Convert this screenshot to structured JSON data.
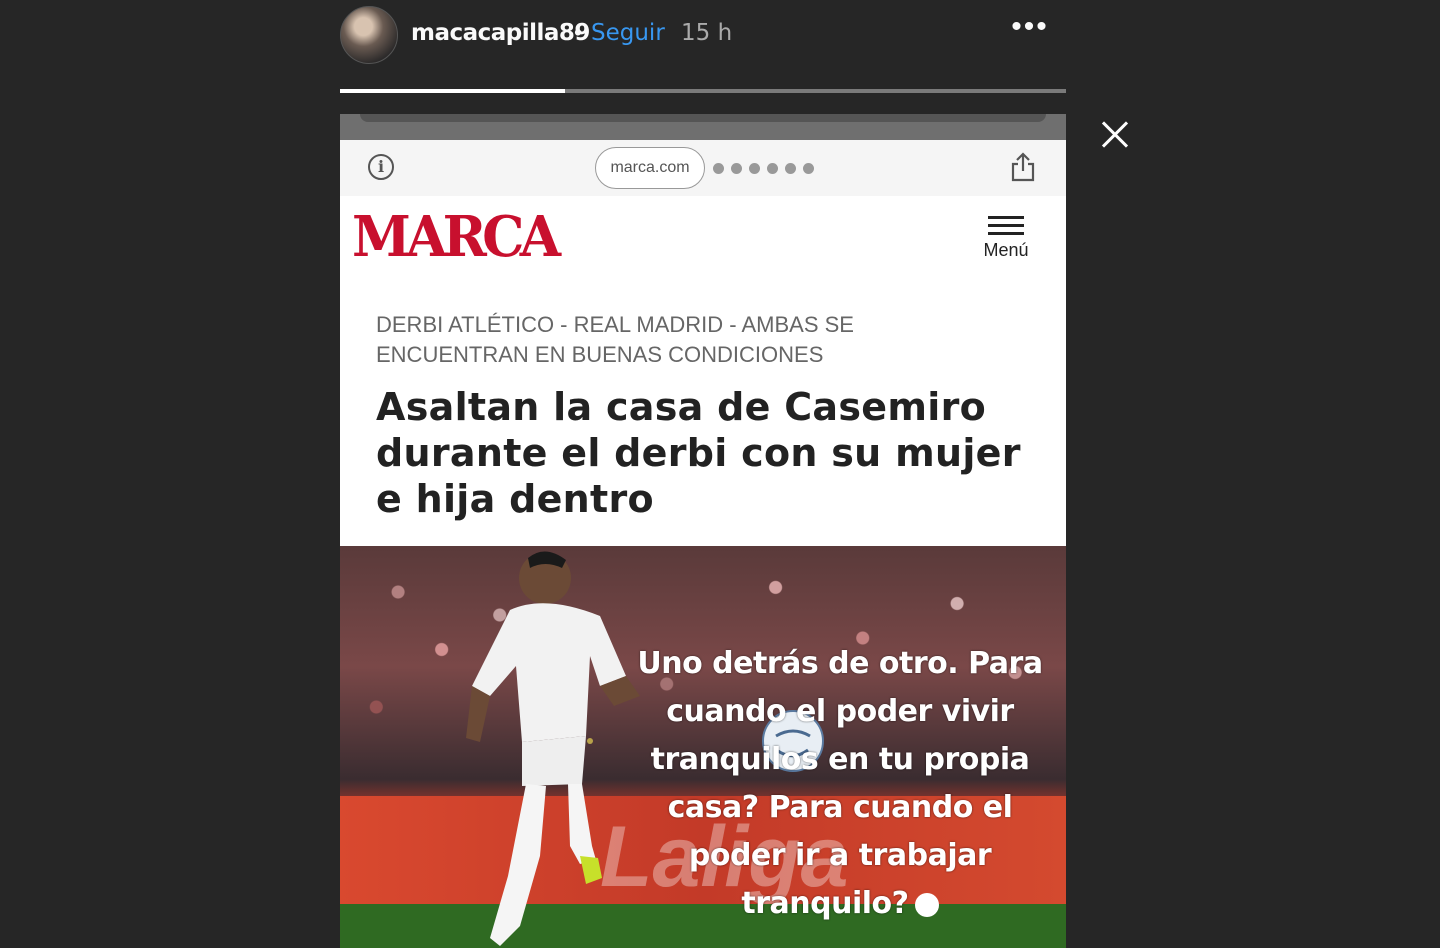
{
  "header": {
    "username": "macacapilla89",
    "separator": "•",
    "follow_label": "Seguir",
    "time": "15 h",
    "more_label": "•••"
  },
  "progress": {
    "segments": 1,
    "current_fraction": 0.31
  },
  "browser": {
    "info_icon": "info-icon",
    "url": "marca.com",
    "share_icon": "share-icon"
  },
  "site": {
    "logo": "MARCA",
    "menu_label": "Menú"
  },
  "article": {
    "kicker": "DERBI ATLÉTICO - REAL MADRID  - AMBAS SE ENCUENTRAN EN BUENAS CONDICIONES",
    "headline": "Asaltan la casa de Casemiro durante el derbi con su mujer e hija dentro"
  },
  "story_text": {
    "lines": [
      "Uno detrás de otro. Para",
      "cuando el poder vivir",
      "tranquilos en tu propia",
      "casa? Para cuando el",
      "poder ir a trabajar",
      "tranquilo?"
    ]
  },
  "colors": {
    "background": "#262626",
    "follow": "#3897f0",
    "logo": "#c8102e"
  }
}
